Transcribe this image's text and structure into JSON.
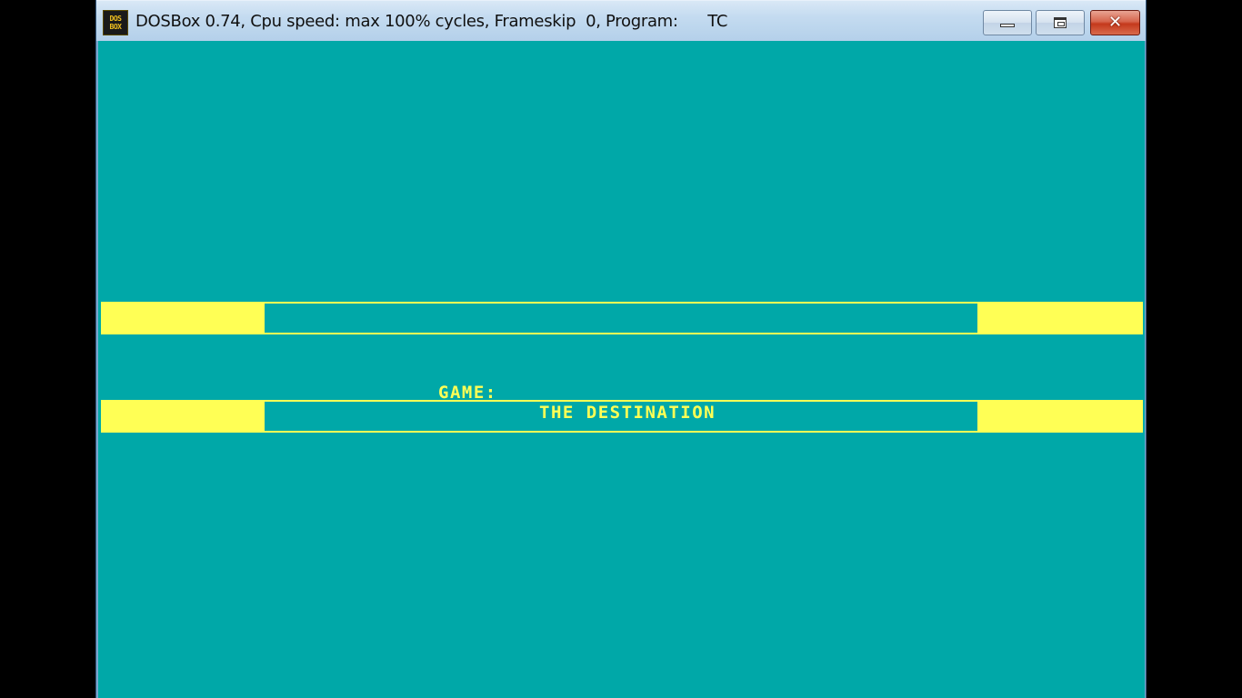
{
  "window": {
    "title": "DOSBox 0.74, Cpu speed: max 100% cycles, Frameskip  0, Program:      TC",
    "icon": {
      "name": "dosbox-app-icon",
      "line1": "DOS",
      "line2": "BOX"
    },
    "controls": {
      "minimize_icon": "minimize-icon",
      "maximize_icon": "maximize-icon",
      "close_icon": "close-icon",
      "close_glyph": "✕"
    }
  },
  "screen": {
    "background_color": "#00a8a8",
    "accent_color": "#ffff55",
    "game_label": "GAME:",
    "game_title": "THE DESTINATION"
  }
}
